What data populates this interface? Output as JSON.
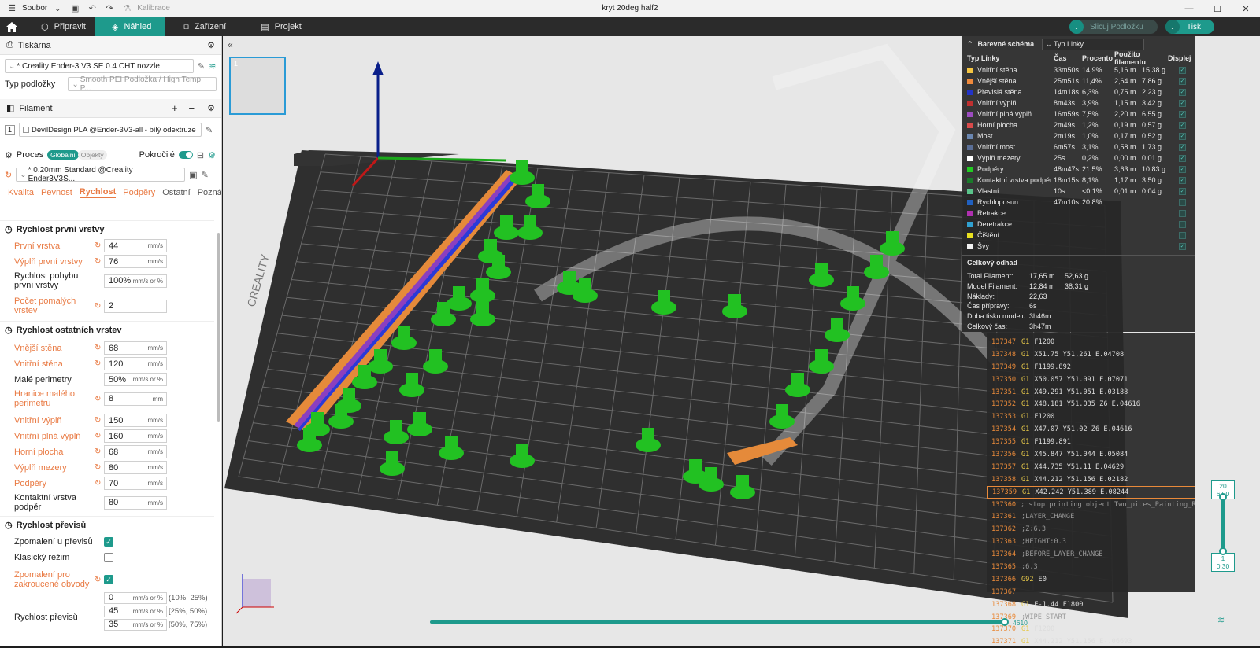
{
  "titlebar": {
    "file_menu": "Soubor",
    "calibration": "Kalibrace",
    "title": "kryt 20deg half2",
    "minimize": "—",
    "maximize": "☐",
    "close": "✕"
  },
  "tabs": [
    {
      "label": "Připravit"
    },
    {
      "label": "Náhled"
    },
    {
      "label": "Zařízení"
    },
    {
      "label": "Projekt"
    }
  ],
  "actions": {
    "slice": "Slicuj Podložku",
    "print": "Tisk"
  },
  "printer": {
    "section": "Tiskárna",
    "name": "* Creality Ender-3 V3 SE 0.4 CHT nozzle",
    "plate_label": "Typ podložky",
    "plate_value": "Smooth PEI Podložka / High Temp P..."
  },
  "filament": {
    "section": "Filament",
    "index": "1",
    "name": "DevilDesign PLA @Ender-3V3-all - bílý odextruze"
  },
  "process": {
    "section": "Proces",
    "global": "Globální",
    "objects": "Objekty",
    "advanced": "Pokročilé",
    "preset": "* 0.20mm Standard @Creality Ender3V3S...",
    "subtabs": [
      "Kvalita",
      "Pevnost",
      "Rychlost",
      "Podpěry",
      "Ostatní",
      "Poznám..."
    ]
  },
  "groups": {
    "first": "Rychlost první vrstvy",
    "other": "Rychlost ostatních vrstev",
    "overhang": "Rychlost převisů"
  },
  "params": [
    {
      "label": "První vrstva",
      "value": "44",
      "unit": "mm/s"
    },
    {
      "label": "Výplň první vrstvy",
      "value": "76",
      "unit": "mm/s"
    },
    {
      "label": "Rychlost pohybu první vrstvy",
      "value": "100%",
      "unit": "mm/s or %"
    },
    {
      "label": "Počet pomalých vrstev",
      "value": "2",
      "unit": ""
    },
    {
      "label": "Vnější stěna",
      "value": "68",
      "unit": "mm/s"
    },
    {
      "label": "Vnitřní stěna",
      "value": "120",
      "unit": "mm/s"
    },
    {
      "label": "Malé perimetry",
      "value": "50%",
      "unit": "mm/s or %"
    },
    {
      "label": "Hranice malého perimetru",
      "value": "8",
      "unit": "mm"
    },
    {
      "label": "Vnitřní výplň",
      "value": "150",
      "unit": "mm/s"
    },
    {
      "label": "Vnitřní plná výplň",
      "value": "160",
      "unit": "mm/s"
    },
    {
      "label": "Horní plocha",
      "value": "68",
      "unit": "mm/s"
    },
    {
      "label": "Výplň mezery",
      "value": "80",
      "unit": "mm/s"
    },
    {
      "label": "Podpěry",
      "value": "70",
      "unit": "mm/s"
    },
    {
      "label": "Kontaktní vrstva podpěr",
      "value": "80",
      "unit": "mm/s"
    }
  ],
  "overhang": {
    "slow": "Zpomalení u převisů",
    "classic": "Klasický režim",
    "curled": "Zpomalení pro zakroucené obvody",
    "speed_label": "Rychlost převisů",
    "rows": [
      {
        "value": "0",
        "unit": "mm/s or %",
        "range": "(10%, 25%)"
      },
      {
        "value": "45",
        "unit": "mm/s or %",
        "range": "[25%, 50%)"
      },
      {
        "value": "35",
        "unit": "mm/s or %",
        "range": "[50%, 75%)"
      }
    ]
  },
  "legend": {
    "title": "Barevné schéma",
    "mode": "Typ Linky",
    "headers": [
      "Typ Linky",
      "Čas",
      "Procento",
      "Použito filamentu",
      "Displej"
    ],
    "rows": [
      {
        "name": "Vnitřní stěna",
        "color": "#f5c542",
        "time": "33m50s",
        "pct": "14,9%",
        "len": "5,16 m",
        "g": "15,38 g",
        "on": true
      },
      {
        "name": "Vnější stěna",
        "color": "#f08a3c",
        "time": "25m51s",
        "pct": "11,4%",
        "len": "2,64 m",
        "g": "7,86 g",
        "on": true
      },
      {
        "name": "Převislá stěna",
        "color": "#2233c8",
        "time": "14m18s",
        "pct": "6,3%",
        "len": "0,75 m",
        "g": "2,23 g",
        "on": true
      },
      {
        "name": "Vnitřní výplň",
        "color": "#c03030",
        "time": "8m43s",
        "pct": "3,9%",
        "len": "1,15 m",
        "g": "3,42 g",
        "on": true
      },
      {
        "name": "Vnitřní plná výplň",
        "color": "#9c4cc0",
        "time": "16m59s",
        "pct": "7,5%",
        "len": "2,20 m",
        "g": "6,55 g",
        "on": true
      },
      {
        "name": "Horní plocha",
        "color": "#d84a4a",
        "time": "2m49s",
        "pct": "1,2%",
        "len": "0,19 m",
        "g": "0,57 g",
        "on": true
      },
      {
        "name": "Most",
        "color": "#6a86b0",
        "time": "2m19s",
        "pct": "1,0%",
        "len": "0,17 m",
        "g": "0,52 g",
        "on": true
      },
      {
        "name": "Vnitřní most",
        "color": "#5a6e96",
        "time": "6m57s",
        "pct": "3,1%",
        "len": "0,58 m",
        "g": "1,73 g",
        "on": true
      },
      {
        "name": "Výplň mezery",
        "color": "#ffffff",
        "time": "25s",
        "pct": "0,2%",
        "len": "0,00 m",
        "g": "0,01 g",
        "on": true
      },
      {
        "name": "Podpěry",
        "color": "#22cc22",
        "time": "48m47s",
        "pct": "21,5%",
        "len": "3,63 m",
        "g": "10,83 g",
        "on": true
      },
      {
        "name": "Kontaktní vrstva podpěr",
        "color": "#1a7a2a",
        "time": "18m15s",
        "pct": "8,1%",
        "len": "1,17 m",
        "g": "3,50 g",
        "on": true
      },
      {
        "name": "Vlastní",
        "color": "#5ac48a",
        "time": "10s",
        "pct": "<0.1%",
        "len": "0,01 m",
        "g": "0,04 g",
        "on": true
      },
      {
        "name": "Rychloposun",
        "color": "#2060c0",
        "time": "47m10s",
        "pct": "20,8%",
        "len": "",
        "g": "",
        "on": false
      },
      {
        "name": "Retrakce",
        "color": "#b030b0",
        "time": "",
        "pct": "",
        "len": "",
        "g": "",
        "on": false
      },
      {
        "name": "Deretrakce",
        "color": "#30a0d0",
        "time": "",
        "pct": "",
        "len": "",
        "g": "",
        "on": false
      },
      {
        "name": "Čištění",
        "color": "#e8e020",
        "time": "",
        "pct": "",
        "len": "",
        "g": "",
        "on": false
      },
      {
        "name": "Švy",
        "color": "#f0f0f0",
        "time": "",
        "pct": "",
        "len": "",
        "g": "",
        "on": true
      }
    ],
    "summary_title": "Celkový odhad",
    "summary": [
      {
        "k": "Total Filament:",
        "a": "17,65 m",
        "b": "52,63 g"
      },
      {
        "k": "Model Filament:",
        "a": "12,84 m",
        "b": "38,31 g"
      },
      {
        "k": "Náklady:",
        "a": "22,63",
        "b": ""
      },
      {
        "k": "Čas přípravy:",
        "a": "6s",
        "b": ""
      },
      {
        "k": "Doba tisku modelu:",
        "a": "3h46m",
        "b": ""
      },
      {
        "k": "Celkový čas:",
        "a": "3h47m",
        "b": ""
      }
    ]
  },
  "gcode": [
    {
      "n": "137347",
      "c": "G1",
      "t": "F1200"
    },
    {
      "n": "137348",
      "c": "G1",
      "t": "X51.75 Y51.261 E.04708"
    },
    {
      "n": "137349",
      "c": "G1",
      "t": "F1199.892"
    },
    {
      "n": "137350",
      "c": "G1",
      "t": "X50.057 Y51.091 E.07071"
    },
    {
      "n": "137351",
      "c": "G1",
      "t": "X49.291 Y51.051 E.03188"
    },
    {
      "n": "137352",
      "c": "G1",
      "t": "X48.181 Y51.035 Z6 E.04616"
    },
    {
      "n": "137353",
      "c": "G1",
      "t": "F1200"
    },
    {
      "n": "137354",
      "c": "G1",
      "t": "X47.07 Y51.02 Z6 E.04616"
    },
    {
      "n": "137355",
      "c": "G1",
      "t": "F1199.891"
    },
    {
      "n": "137356",
      "c": "G1",
      "t": "X45.847 Y51.044 E.05084"
    },
    {
      "n": "137357",
      "c": "G1",
      "t": "X44.735 Y51.11 E.04629"
    },
    {
      "n": "137358",
      "c": "G1",
      "t": "X44.212 Y51.156 E.02182"
    },
    {
      "n": "137359",
      "c": "G1",
      "t": "X42.242 Y51.389 E.08244",
      "cur": true
    },
    {
      "n": "137360",
      "c": "",
      "t": "; stop printing object Two_pices_Painting_RTX40gamin...",
      "cm": true
    },
    {
      "n": "137361",
      "c": "",
      "t": ";LAYER_CHANGE",
      "cm": true
    },
    {
      "n": "137362",
      "c": "",
      "t": ";Z:6.3",
      "cm": true
    },
    {
      "n": "137363",
      "c": "",
      "t": ";HEIGHT:0.3",
      "cm": true
    },
    {
      "n": "137364",
      "c": "",
      "t": ";BEFORE_LAYER_CHANGE",
      "cm": true
    },
    {
      "n": "137365",
      "c": "",
      "t": ";6.3",
      "cm": true
    },
    {
      "n": "137366",
      "c": "G92",
      "t": "E0"
    },
    {
      "n": "137367",
      "c": "",
      "t": ""
    },
    {
      "n": "137368",
      "c": "G1",
      "t": "E-1.44 F1800"
    },
    {
      "n": "137369",
      "c": "",
      "t": ";WIPE_START",
      "cm": true
    },
    {
      "n": "137370",
      "c": "G1",
      "t": "F1200"
    },
    {
      "n": "137371",
      "c": "G1",
      "t": "X44.212 Y51.156 E-.06693"
    }
  ],
  "layers": {
    "top_num": "20",
    "top_h": "6,00",
    "bot_num": "1",
    "bot_h": "0,30"
  },
  "moves": {
    "value": "4610"
  },
  "plate_brand": "CREALITY"
}
